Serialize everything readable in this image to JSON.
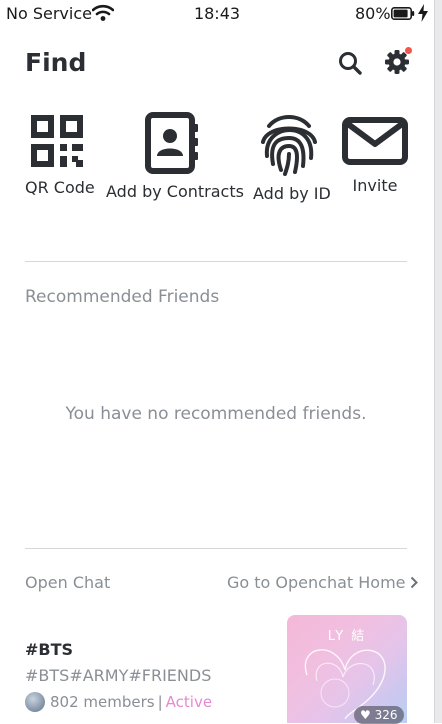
{
  "status_bar": {
    "carrier": "No Service",
    "time": "18:43",
    "battery_percent": "80%"
  },
  "header": {
    "title": "Find",
    "icons": [
      "search-icon",
      "gear-icon"
    ],
    "notification_dot_color": "#f0564a"
  },
  "actions": [
    {
      "label": "QR Code",
      "icon": "qr-code-icon"
    },
    {
      "label": "Add by Contracts",
      "icon": "contacts-book-icon"
    },
    {
      "label": "Add by ID",
      "icon": "fingerprint-icon"
    },
    {
      "label": "Invite",
      "icon": "envelope-icon"
    }
  ],
  "recommended": {
    "title": "Recommended Friends",
    "empty_message": "You have no recommended friends."
  },
  "open_chat": {
    "label": "Open Chat",
    "home_link": "Go to Openchat Home",
    "item": {
      "name": "#BTS",
      "tags": "#BTS#ARMY#FRIENDS",
      "members": "802 members",
      "separator": "|",
      "status": "Active",
      "status_color": "#e58ad1",
      "thumbnail_text": "LY 結",
      "likes": "326"
    }
  }
}
